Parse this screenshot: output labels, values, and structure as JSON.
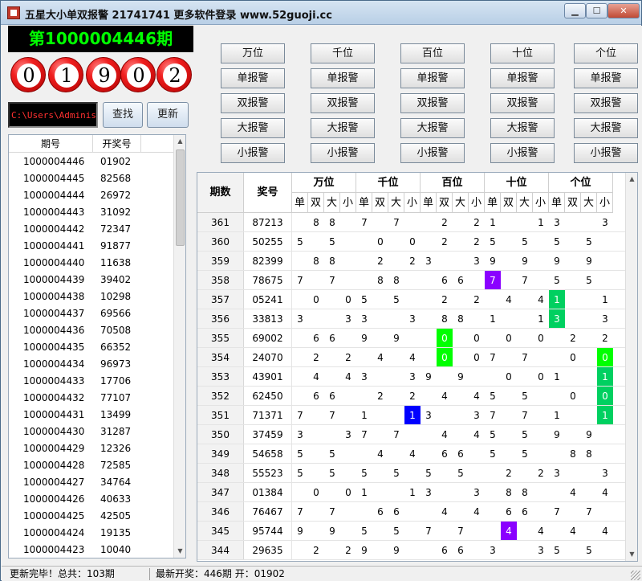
{
  "window": {
    "title": "五星大小单双报警 21741741 更多软件登录 www.52guoji.cc",
    "min_label": "▁",
    "max_label": "☐",
    "close_label": "✕"
  },
  "draw": {
    "period": "第1000004446期",
    "numbers": [
      "0",
      "1",
      "9",
      "0",
      "2"
    ]
  },
  "path_input": {
    "value": "C:\\Users\\Administr"
  },
  "buttons": {
    "find": "查找",
    "update": "更新"
  },
  "history": {
    "columns": [
      "期号",
      "开奖号"
    ],
    "rows": [
      [
        "1000004446",
        "01902"
      ],
      [
        "1000004445",
        "82568"
      ],
      [
        "1000004444",
        "26972"
      ],
      [
        "1000004443",
        "31092"
      ],
      [
        "1000004442",
        "72347"
      ],
      [
        "1000004441",
        "91877"
      ],
      [
        "1000004440",
        "11638"
      ],
      [
        "1000004439",
        "39402"
      ],
      [
        "1000004438",
        "10298"
      ],
      [
        "1000004437",
        "69566"
      ],
      [
        "1000004436",
        "70508"
      ],
      [
        "1000004435",
        "66352"
      ],
      [
        "1000004434",
        "96973"
      ],
      [
        "1000004433",
        "17706"
      ],
      [
        "1000004432",
        "77107"
      ],
      [
        "1000004431",
        "13499"
      ],
      [
        "1000004430",
        "31287"
      ],
      [
        "1000004429",
        "12326"
      ],
      [
        "1000004428",
        "72585"
      ],
      [
        "1000004427",
        "34764"
      ],
      [
        "1000004426",
        "40633"
      ],
      [
        "1000004425",
        "42505"
      ],
      [
        "1000004424",
        "19135"
      ],
      [
        "1000004423",
        "10040"
      ]
    ]
  },
  "alarm_panel": {
    "positions": [
      "万位",
      "千位",
      "百位",
      "十位",
      "个位"
    ],
    "alarm_labels": [
      "单报警",
      "双报警",
      "大报警",
      "小报警"
    ]
  },
  "grid": {
    "col_period": "期数",
    "col_number": "奖号",
    "groups": [
      "万位",
      "千位",
      "百位",
      "十位",
      "个位"
    ],
    "subs": [
      "单",
      "双",
      "大",
      "小"
    ],
    "rows": [
      {
        "period": "361",
        "number": "87213",
        "cells": [
          "",
          "8",
          "8",
          "",
          "7",
          "",
          "7",
          "",
          "",
          "2",
          "",
          "2",
          "1",
          "",
          "",
          "1",
          "3",
          "",
          "",
          "3"
        ]
      },
      {
        "period": "360",
        "number": "50255",
        "cells": [
          "5",
          "",
          "5",
          "",
          "",
          "0",
          "",
          "0",
          "",
          "2",
          "",
          "2",
          "5",
          "",
          "5",
          "",
          "5",
          "",
          "5",
          ""
        ]
      },
      {
        "period": "359",
        "number": "82399",
        "cells": [
          "",
          "8",
          "8",
          "",
          "",
          "2",
          "",
          "2",
          "3",
          "",
          "",
          "3",
          "9",
          "",
          "9",
          "",
          "9",
          "",
          "9",
          ""
        ]
      },
      {
        "period": "358",
        "number": "78675",
        "cells": [
          "7",
          "",
          "7",
          "",
          "",
          "8",
          "8",
          "",
          "",
          "6",
          "6",
          "",
          "7",
          "",
          "7",
          "",
          "5",
          "",
          "5",
          ""
        ]
      },
      {
        "period": "357",
        "number": "05241",
        "cells": [
          "",
          "0",
          "",
          "0",
          "5",
          "",
          "5",
          "",
          "",
          "2",
          "",
          "2",
          "",
          "4",
          "",
          "4",
          "1",
          "",
          "",
          "1"
        ]
      },
      {
        "period": "356",
        "number": "33813",
        "cells": [
          "3",
          "",
          "",
          "3",
          "3",
          "",
          "",
          "3",
          "",
          "8",
          "8",
          "",
          "1",
          "",
          "",
          "1",
          "3",
          "",
          "",
          "3"
        ]
      },
      {
        "period": "355",
        "number": "69002",
        "cells": [
          "",
          "6",
          "6",
          "",
          "9",
          "",
          "9",
          "",
          "",
          "0",
          "",
          "0",
          "",
          "0",
          "",
          "0",
          "",
          "2",
          "",
          "2"
        ]
      },
      {
        "period": "354",
        "number": "24070",
        "cells": [
          "",
          "2",
          "",
          "2",
          "",
          "4",
          "",
          "4",
          "",
          "0",
          "",
          "0",
          "7",
          "",
          "7",
          "",
          "",
          "0",
          "",
          "0"
        ]
      },
      {
        "period": "353",
        "number": "43901",
        "cells": [
          "",
          "4",
          "",
          "4",
          "3",
          "",
          "",
          "3",
          "9",
          "",
          "9",
          "",
          "",
          "0",
          "",
          "0",
          "1",
          "",
          "",
          "1"
        ]
      },
      {
        "period": "352",
        "number": "62450",
        "cells": [
          "",
          "6",
          "6",
          "",
          "",
          "2",
          "",
          "2",
          "",
          "4",
          "",
          "4",
          "5",
          "",
          "5",
          "",
          "",
          "0",
          "",
          "0"
        ]
      },
      {
        "period": "351",
        "number": "71371",
        "cells": [
          "7",
          "",
          "7",
          "",
          "1",
          "",
          "",
          "1",
          "3",
          "",
          "",
          "3",
          "7",
          "",
          "7",
          "",
          "1",
          "",
          "",
          "1"
        ]
      },
      {
        "period": "350",
        "number": "37459",
        "cells": [
          "3",
          "",
          "",
          "3",
          "7",
          "",
          "7",
          "",
          "",
          "4",
          "",
          "4",
          "5",
          "",
          "5",
          "",
          "9",
          "",
          "9",
          ""
        ]
      },
      {
        "period": "349",
        "number": "54658",
        "cells": [
          "5",
          "",
          "5",
          "",
          "",
          "4",
          "",
          "4",
          "",
          "6",
          "6",
          "",
          "5",
          "",
          "5",
          "",
          "",
          "8",
          "8",
          ""
        ]
      },
      {
        "period": "348",
        "number": "55523",
        "cells": [
          "5",
          "",
          "5",
          "",
          "5",
          "",
          "5",
          "",
          "5",
          "",
          "5",
          "",
          "",
          "2",
          "",
          "2",
          "3",
          "",
          "",
          "3"
        ]
      },
      {
        "period": "347",
        "number": "01384",
        "cells": [
          "",
          "0",
          "",
          "0",
          "1",
          "",
          "",
          "1",
          "3",
          "",
          "",
          "3",
          "",
          "8",
          "8",
          "",
          "",
          "4",
          "",
          "4"
        ]
      },
      {
        "period": "346",
        "number": "76467",
        "cells": [
          "7",
          "",
          "7",
          "",
          "",
          "6",
          "6",
          "",
          "",
          "4",
          "",
          "4",
          "",
          "6",
          "6",
          "",
          "7",
          "",
          "7",
          ""
        ]
      },
      {
        "period": "345",
        "number": "95744",
        "cells": [
          "9",
          "",
          "9",
          "",
          "5",
          "",
          "5",
          "",
          "7",
          "",
          "7",
          "",
          "",
          "4",
          "",
          "4",
          "",
          "4",
          "",
          "4"
        ]
      },
      {
        "period": "344",
        "number": "29635",
        "cells": [
          "",
          "2",
          "",
          "2",
          "9",
          "",
          "9",
          "",
          "",
          "6",
          "6",
          "",
          "3",
          "",
          "",
          "3",
          "5",
          "",
          "5",
          ""
        ]
      }
    ],
    "highlights": [
      {
        "row": 3,
        "col": 12,
        "color": "#8a00ff"
      },
      {
        "row": 4,
        "col": 16,
        "color": "#00d060"
      },
      {
        "row": 5,
        "col": 16,
        "color": "#00d060"
      },
      {
        "row": 6,
        "col": 9,
        "color": "#00ff00"
      },
      {
        "row": 7,
        "col": 9,
        "color": "#00ff00"
      },
      {
        "row": 7,
        "col": 19,
        "color": "#00ff00"
      },
      {
        "row": 8,
        "col": 19,
        "color": "#00d060"
      },
      {
        "row": 9,
        "col": 19,
        "color": "#00d060"
      },
      {
        "row": 10,
        "col": 7,
        "color": "#0000ff"
      },
      {
        "row": 10,
        "col": 19,
        "color": "#00d060"
      },
      {
        "row": 16,
        "col": 13,
        "color": "#8a00ff"
      }
    ]
  },
  "status": {
    "left": "更新完毕！总共：103期",
    "right": "最新开奖：446期 开：01902"
  }
}
